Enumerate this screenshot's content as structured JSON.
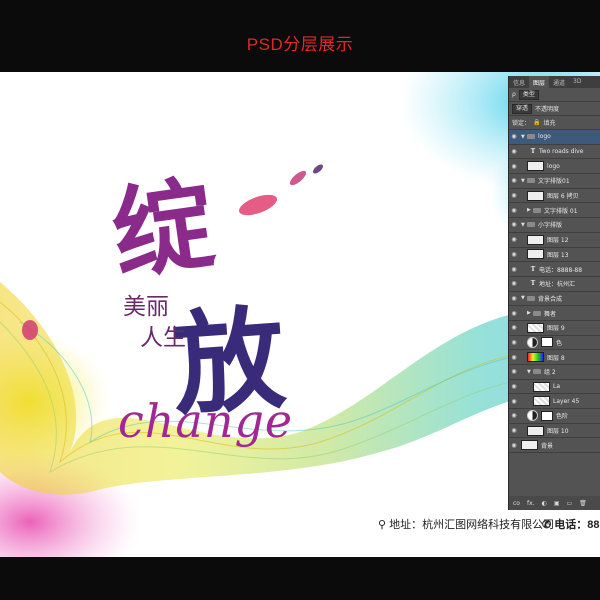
{
  "header": {
    "title": "PSD分层展示"
  },
  "poster": {
    "char_1": "绽",
    "char_2": "放",
    "subtitle_line_1": "美丽",
    "subtitle_line_2": "人生",
    "change_word": "change",
    "address": "地址：杭州汇图网络科技有限公司",
    "phone": "电话：88"
  },
  "panel": {
    "tabs": [
      "信息",
      "图层",
      "通道",
      "3D"
    ],
    "filter_label": "类型",
    "blend_mode": "穿透",
    "opacity_label": "不透明度",
    "lock_label": "锁定：",
    "fill_label": "填充",
    "footer_icons": [
      "co",
      "fx.",
      "◐",
      "▣",
      "▭",
      "🗑"
    ],
    "layers": [
      {
        "name": "logo",
        "kind": "group",
        "level": 0,
        "open": true,
        "selected": true
      },
      {
        "name": "Two roads dive",
        "kind": "text",
        "level": 1
      },
      {
        "name": "logo",
        "kind": "thumb",
        "level": 1
      },
      {
        "name": "文字排版01",
        "kind": "group",
        "level": 0,
        "open": true
      },
      {
        "name": "图层 6 拷贝",
        "kind": "thumb",
        "level": 1
      },
      {
        "name": "文字排版 01",
        "kind": "group",
        "level": 1,
        "open": false
      },
      {
        "name": "小字排版",
        "kind": "group",
        "level": 0,
        "open": true
      },
      {
        "name": "图层 12",
        "kind": "thumb",
        "level": 1
      },
      {
        "name": "图层 13",
        "kind": "thumb",
        "level": 1
      },
      {
        "name": "电话：8888-88",
        "kind": "text",
        "level": 1
      },
      {
        "name": "地址：杭州汇",
        "kind": "text",
        "level": 1
      },
      {
        "name": "背景合成",
        "kind": "group",
        "level": 0,
        "open": true
      },
      {
        "name": "舞者",
        "kind": "group",
        "level": 1,
        "open": false
      },
      {
        "name": "图层 9",
        "kind": "checker",
        "level": 1
      },
      {
        "name": "色",
        "kind": "adjust",
        "level": 1
      },
      {
        "name": "图层 8",
        "kind": "color",
        "level": 1
      },
      {
        "name": "组 2",
        "kind": "group",
        "level": 1,
        "open": true
      },
      {
        "name": "La",
        "kind": "checker",
        "level": 2
      },
      {
        "name": "Layer 45",
        "kind": "checker",
        "level": 2
      },
      {
        "name": "色阶",
        "kind": "adjust",
        "level": 1
      },
      {
        "name": "图层 10",
        "kind": "thumb",
        "level": 1
      },
      {
        "name": "背景",
        "kind": "thumb",
        "level": 0
      }
    ]
  }
}
